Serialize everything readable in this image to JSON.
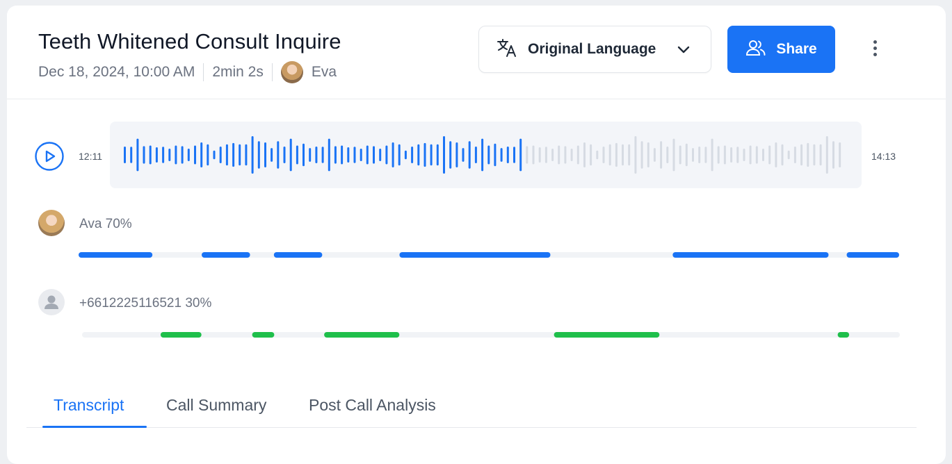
{
  "header": {
    "title": "Teeth Whitened Consult Inquire",
    "date": "Dec 18, 2024, 10:00 AM",
    "duration": "2min 2s",
    "agent_name": "Eva"
  },
  "language_select": {
    "label": "Original Language"
  },
  "share_button": {
    "label": "Share"
  },
  "player": {
    "start_time": "12:11",
    "end_time": "14:13",
    "played_fraction": 0.56,
    "played_color": "#1a73f5",
    "unplayed_color": "#d6dbe3"
  },
  "speakers": [
    {
      "label": "Ava 70%",
      "color": "#1a73f5",
      "segments": [
        [
          0.0,
          0.09
        ],
        [
          0.15,
          0.209
        ],
        [
          0.238,
          0.297
        ],
        [
          0.391,
          0.575
        ],
        [
          0.724,
          0.914
        ],
        [
          0.936,
          1.0
        ]
      ]
    },
    {
      "label": "+6612225116521 30%",
      "color": "#1fbf4b",
      "segments": [
        [
          0.096,
          0.146
        ],
        [
          0.208,
          0.235
        ],
        [
          0.296,
          0.388
        ],
        [
          0.577,
          0.706
        ],
        [
          0.924,
          0.938
        ]
      ]
    }
  ],
  "tabs": [
    {
      "label": "Transcript",
      "active": true
    },
    {
      "label": "Call Summary",
      "active": false
    },
    {
      "label": "Post Call Analysis",
      "active": false
    }
  ]
}
